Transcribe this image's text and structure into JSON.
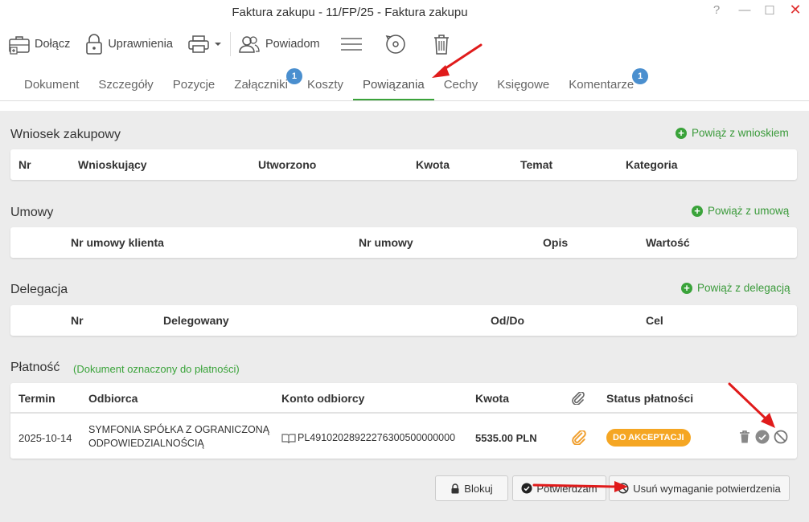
{
  "window": {
    "title": "Faktura zakupu - 11/FP/25 - Faktura zakupu",
    "help": "?",
    "minimize": "—",
    "maximize": "☐",
    "close": "✕"
  },
  "toolbar": {
    "attach": "Dołącz",
    "permissions": "Uprawnienia",
    "notify": "Powiadom"
  },
  "tabs": [
    {
      "label": "Dokument"
    },
    {
      "label": "Szczegóły"
    },
    {
      "label": "Pozycje"
    },
    {
      "label": "Załączniki",
      "badge": "1"
    },
    {
      "label": "Koszty"
    },
    {
      "label": "Powiązania"
    },
    {
      "label": "Cechy"
    },
    {
      "label": "Księgowe"
    },
    {
      "label": "Komentarze",
      "badge": "1"
    }
  ],
  "purchase_request": {
    "title": "Wniosek zakupowy",
    "action": "Powiąż z wnioskiem",
    "columns": [
      "Nr",
      "Wnioskujący",
      "Utworzono",
      "Kwota",
      "Temat",
      "Kategoria"
    ]
  },
  "contracts": {
    "title": "Umowy",
    "action": "Powiąż z umową",
    "columns": [
      "Nr umowy klienta",
      "Nr umowy",
      "Opis",
      "Wartość"
    ]
  },
  "delegation": {
    "title": "Delegacja",
    "action": "Powiąż z delegacją",
    "columns": [
      "Nr",
      "Delegowany",
      "Od/Do",
      "Cel"
    ]
  },
  "payment": {
    "title": "Płatność",
    "note": "(Dokument oznaczony do płatności)",
    "columns": [
      "Termin",
      "Odbiorca",
      "Konto odbiorcy",
      "Kwota",
      "Status płatności"
    ],
    "row": {
      "due": "2025-10-14",
      "recipient_line1": "SYMFONIA SPÓŁKA Z OGRANICZONĄ",
      "recipient_line2": "ODPOWIEDZIALNOŚCIĄ",
      "account": "PL49102028922276300500000000",
      "amount": "5535.00 PLN",
      "status": "DO AKCEPTACJI"
    }
  },
  "buttons": {
    "block": "Blokuj",
    "confirm": "Potwierdzam",
    "remove_requirement": "Usuń wymaganie potwierdzenia"
  },
  "colors": {
    "accent_green": "#3aa33a",
    "badge_blue": "#4a8fcf",
    "status_orange": "#f5a623",
    "annotation_red": "#e01b1b"
  }
}
